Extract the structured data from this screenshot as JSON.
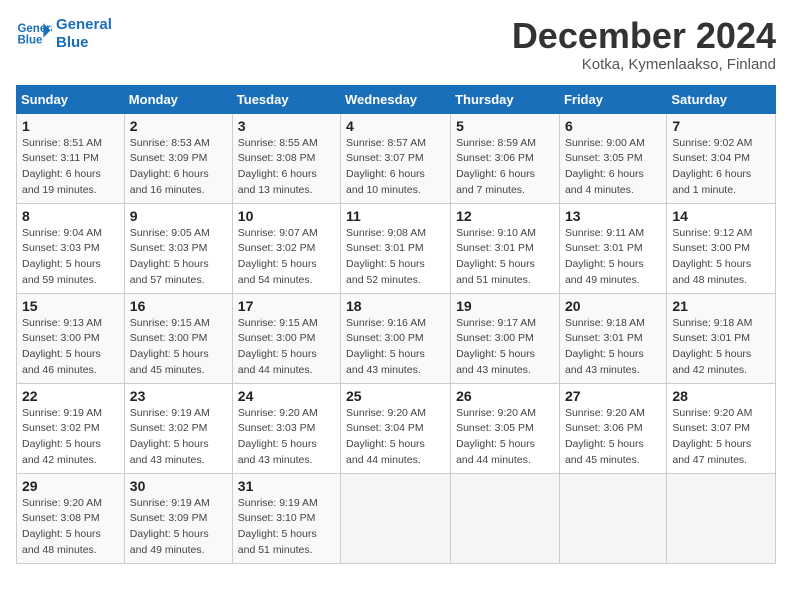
{
  "header": {
    "logo_line1": "General",
    "logo_line2": "Blue",
    "month_title": "December 2024",
    "location": "Kotka, Kymenlaakso, Finland"
  },
  "days_of_week": [
    "Sunday",
    "Monday",
    "Tuesday",
    "Wednesday",
    "Thursday",
    "Friday",
    "Saturday"
  ],
  "weeks": [
    [
      {
        "day": "1",
        "sunrise": "8:51 AM",
        "sunset": "3:11 PM",
        "daylight": "6 hours and 19 minutes."
      },
      {
        "day": "2",
        "sunrise": "8:53 AM",
        "sunset": "3:09 PM",
        "daylight": "6 hours and 16 minutes."
      },
      {
        "day": "3",
        "sunrise": "8:55 AM",
        "sunset": "3:08 PM",
        "daylight": "6 hours and 13 minutes."
      },
      {
        "day": "4",
        "sunrise": "8:57 AM",
        "sunset": "3:07 PM",
        "daylight": "6 hours and 10 minutes."
      },
      {
        "day": "5",
        "sunrise": "8:59 AM",
        "sunset": "3:06 PM",
        "daylight": "6 hours and 7 minutes."
      },
      {
        "day": "6",
        "sunrise": "9:00 AM",
        "sunset": "3:05 PM",
        "daylight": "6 hours and 4 minutes."
      },
      {
        "day": "7",
        "sunrise": "9:02 AM",
        "sunset": "3:04 PM",
        "daylight": "6 hours and 1 minute."
      }
    ],
    [
      {
        "day": "8",
        "sunrise": "9:04 AM",
        "sunset": "3:03 PM",
        "daylight": "5 hours and 59 minutes."
      },
      {
        "day": "9",
        "sunrise": "9:05 AM",
        "sunset": "3:03 PM",
        "daylight": "5 hours and 57 minutes."
      },
      {
        "day": "10",
        "sunrise": "9:07 AM",
        "sunset": "3:02 PM",
        "daylight": "5 hours and 54 minutes."
      },
      {
        "day": "11",
        "sunrise": "9:08 AM",
        "sunset": "3:01 PM",
        "daylight": "5 hours and 52 minutes."
      },
      {
        "day": "12",
        "sunrise": "9:10 AM",
        "sunset": "3:01 PM",
        "daylight": "5 hours and 51 minutes."
      },
      {
        "day": "13",
        "sunrise": "9:11 AM",
        "sunset": "3:01 PM",
        "daylight": "5 hours and 49 minutes."
      },
      {
        "day": "14",
        "sunrise": "9:12 AM",
        "sunset": "3:00 PM",
        "daylight": "5 hours and 48 minutes."
      }
    ],
    [
      {
        "day": "15",
        "sunrise": "9:13 AM",
        "sunset": "3:00 PM",
        "daylight": "5 hours and 46 minutes."
      },
      {
        "day": "16",
        "sunrise": "9:15 AM",
        "sunset": "3:00 PM",
        "daylight": "5 hours and 45 minutes."
      },
      {
        "day": "17",
        "sunrise": "9:15 AM",
        "sunset": "3:00 PM",
        "daylight": "5 hours and 44 minutes."
      },
      {
        "day": "18",
        "sunrise": "9:16 AM",
        "sunset": "3:00 PM",
        "daylight": "5 hours and 43 minutes."
      },
      {
        "day": "19",
        "sunrise": "9:17 AM",
        "sunset": "3:00 PM",
        "daylight": "5 hours and 43 minutes."
      },
      {
        "day": "20",
        "sunrise": "9:18 AM",
        "sunset": "3:01 PM",
        "daylight": "5 hours and 43 minutes."
      },
      {
        "day": "21",
        "sunrise": "9:18 AM",
        "sunset": "3:01 PM",
        "daylight": "5 hours and 42 minutes."
      }
    ],
    [
      {
        "day": "22",
        "sunrise": "9:19 AM",
        "sunset": "3:02 PM",
        "daylight": "5 hours and 42 minutes."
      },
      {
        "day": "23",
        "sunrise": "9:19 AM",
        "sunset": "3:02 PM",
        "daylight": "5 hours and 43 minutes."
      },
      {
        "day": "24",
        "sunrise": "9:20 AM",
        "sunset": "3:03 PM",
        "daylight": "5 hours and 43 minutes."
      },
      {
        "day": "25",
        "sunrise": "9:20 AM",
        "sunset": "3:04 PM",
        "daylight": "5 hours and 44 minutes."
      },
      {
        "day": "26",
        "sunrise": "9:20 AM",
        "sunset": "3:05 PM",
        "daylight": "5 hours and 44 minutes."
      },
      {
        "day": "27",
        "sunrise": "9:20 AM",
        "sunset": "3:06 PM",
        "daylight": "5 hours and 45 minutes."
      },
      {
        "day": "28",
        "sunrise": "9:20 AM",
        "sunset": "3:07 PM",
        "daylight": "5 hours and 47 minutes."
      }
    ],
    [
      {
        "day": "29",
        "sunrise": "9:20 AM",
        "sunset": "3:08 PM",
        "daylight": "5 hours and 48 minutes."
      },
      {
        "day": "30",
        "sunrise": "9:19 AM",
        "sunset": "3:09 PM",
        "daylight": "5 hours and 49 minutes."
      },
      {
        "day": "31",
        "sunrise": "9:19 AM",
        "sunset": "3:10 PM",
        "daylight": "5 hours and 51 minutes."
      },
      null,
      null,
      null,
      null
    ]
  ]
}
